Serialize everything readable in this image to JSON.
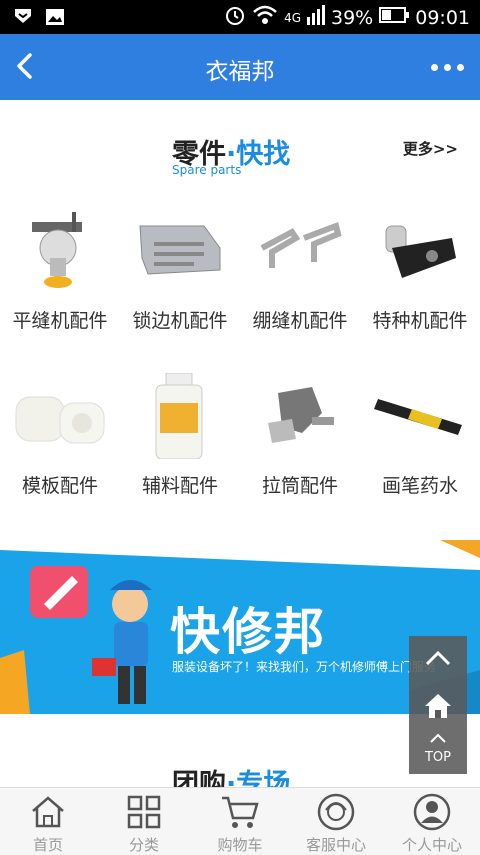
{
  "status_bar": {
    "network": "4G",
    "battery": "39%",
    "time": "09:01",
    "icons": [
      "notification-icon",
      "image-icon",
      "alarm-icon",
      "wifi-icon",
      "signal-icon",
      "battery-icon"
    ]
  },
  "app_bar": {
    "title": "衣福邦",
    "back_icon": "chevron-left-icon",
    "more_icon": "more-dots-icon"
  },
  "spare_parts": {
    "title_a": "零件",
    "title_dot": "·",
    "title_b": "快找",
    "subtitle": "Spare parts",
    "more": "更多>>",
    "items": [
      {
        "label": "平缝机配件"
      },
      {
        "label": "锁边机配件"
      },
      {
        "label": "绷缝机配件"
      },
      {
        "label": "特种机配件"
      },
      {
        "label": "模板配件"
      },
      {
        "label": "辅料配件"
      },
      {
        "label": "拉筒配件"
      },
      {
        "label": "画笔药水"
      }
    ]
  },
  "banner": {
    "title": "快修邦",
    "subtitle": "服装设备坏了！来找我们，万个机修师傅上门服务"
  },
  "group_buy": {
    "title_a": "团购",
    "title_dot": "·",
    "title_b": "专场"
  },
  "float_buttons": {
    "top_label": "TOP"
  },
  "tab_bar": {
    "tabs": [
      {
        "label": "首页",
        "icon": "home-icon"
      },
      {
        "label": "分类",
        "icon": "category-grid-icon"
      },
      {
        "label": "购物车",
        "icon": "cart-icon"
      },
      {
        "label": "客服中心",
        "icon": "customer-service-icon"
      },
      {
        "label": "个人中心",
        "icon": "user-icon"
      }
    ]
  },
  "colors": {
    "app_bar": "#2f7fe0",
    "accent": "#1a8de0",
    "banner": "#1aa3e8"
  }
}
